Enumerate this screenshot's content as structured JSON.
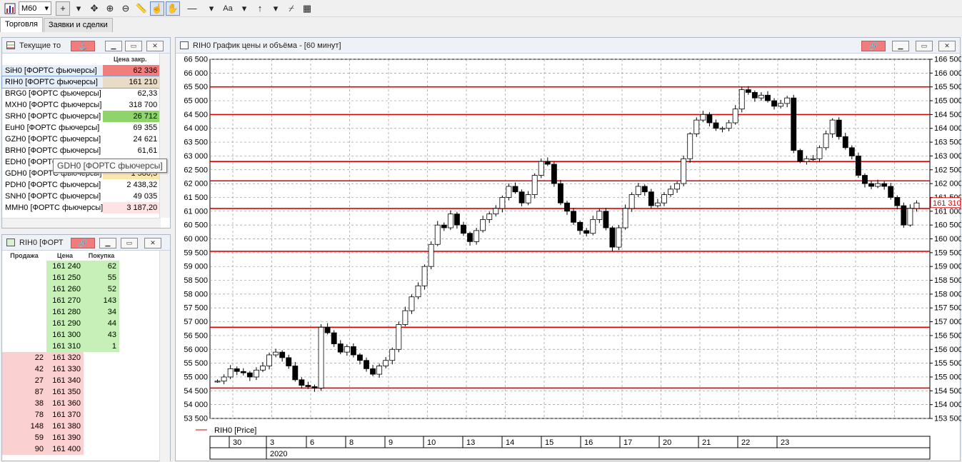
{
  "toolbar": {
    "timeframe": "M60",
    "font_label": "Aa"
  },
  "tabs": [
    {
      "label": "Торговля"
    },
    {
      "label": "Заявки и сделки"
    }
  ],
  "trades_panel": {
    "title": "Текущие то",
    "col_price": "Цена закр.",
    "rows": [
      {
        "name": "SiH0 [ФОРТС фьючерсы]",
        "price": "62 336",
        "bg": "#f17d7d"
      },
      {
        "name": "RIH0 [ФОРТС фьючерсы]",
        "price": "161 210",
        "bg": "#e8dcc7"
      },
      {
        "name": "BRG0 [ФОРТС фьючерсы]",
        "price": "62,33",
        "bg": ""
      },
      {
        "name": "MXH0 [ФОРТС фьючерсы]",
        "price": "318 700",
        "bg": ""
      },
      {
        "name": "SRH0 [ФОРТС фьючерсы]",
        "price": "26 712",
        "bg": "#8fd46a"
      },
      {
        "name": "EuH0 [ФОРТС фьючерсы]",
        "price": "69 355",
        "bg": ""
      },
      {
        "name": "GZH0 [ФОРТС фьючерсы]",
        "price": "24 621",
        "bg": ""
      },
      {
        "name": "BRH0 [ФОРТС фьючерсы]",
        "price": "61,61",
        "bg": ""
      },
      {
        "name": "EDH0 [ФОРТС фьючерсы]",
        "price": "",
        "bg": ""
      },
      {
        "name": "GDH0 [ФОРТС фьючерсы]",
        "price": "1 580,5",
        "bg": "#fbe6ad"
      },
      {
        "name": "PDH0 [ФОРТС фьючерсы]",
        "price": "2 438,32",
        "bg": ""
      },
      {
        "name": "SNH0 [ФОРТС фьючерсы]",
        "price": "49 035",
        "bg": ""
      },
      {
        "name": "MMH0 [ФОРТС фьючерсы]",
        "price": "3 187,20",
        "bg": "#fde3e3"
      }
    ],
    "tooltip": "GDH0 [ФОРТС фьючерсы]"
  },
  "orderbook": {
    "title": "RIH0 [ФОРТ",
    "col_sell": "Продажа",
    "col_price": "Цена",
    "col_buy": "Покупка",
    "bids": [
      {
        "price": "161 240",
        "qty": "62"
      },
      {
        "price": "161 250",
        "qty": "55"
      },
      {
        "price": "161 260",
        "qty": "52"
      },
      {
        "price": "161 270",
        "qty": "143"
      },
      {
        "price": "161 280",
        "qty": "34"
      },
      {
        "price": "161 290",
        "qty": "44"
      },
      {
        "price": "161 300",
        "qty": "43"
      },
      {
        "price": "161 310",
        "qty": "1"
      }
    ],
    "asks": [
      {
        "price": "161 320",
        "qty": "22"
      },
      {
        "price": "161 330",
        "qty": "42"
      },
      {
        "price": "161 340",
        "qty": "27"
      },
      {
        "price": "161 350",
        "qty": "87"
      },
      {
        "price": "161 360",
        "qty": "38"
      },
      {
        "price": "161 370",
        "qty": "78"
      },
      {
        "price": "161 380",
        "qty": "148"
      },
      {
        "price": "161 390",
        "qty": "59"
      },
      {
        "price": "161 400",
        "qty": "90"
      }
    ]
  },
  "chart_window": {
    "title": "RIH0 График цены и объёма - [60 минут]",
    "legend": "RIH0 [Price]",
    "last_price_label": "161 310",
    "year_label": "2020"
  },
  "chart_data": {
    "type": "candlestick",
    "left_axis": {
      "min": 53500,
      "max": 66500,
      "step": 500
    },
    "right_axis": {
      "min": 153500,
      "max": 166500,
      "step": 500
    },
    "x_days": [
      "30",
      "3",
      "6",
      "8",
      "9",
      "10",
      "13",
      "14",
      "15",
      "16",
      "17",
      "20",
      "21",
      "22",
      "23"
    ],
    "level_lines": [
      65500,
      64500,
      62800,
      62100,
      61100,
      59550,
      56800,
      54600
    ],
    "last_price": 161310,
    "series": [
      {
        "name": "RIH0 [Price]",
        "values": [
          154850,
          155000,
          155300,
          155200,
          155150,
          155000,
          155250,
          155400,
          155800,
          155900,
          155700,
          155400,
          154900,
          154700,
          154650,
          154600,
          156800,
          156600,
          156200,
          155900,
          156100,
          155800,
          155600,
          155300,
          155100,
          155400,
          155600,
          156000,
          156900,
          157400,
          157900,
          158300,
          159000,
          159800,
          160500,
          160400,
          160900,
          160500,
          160200,
          159900,
          160300,
          160700,
          160900,
          161100,
          161500,
          161900,
          161700,
          161300,
          161600,
          162300,
          162800,
          162700,
          162000,
          161300,
          161000,
          160600,
          160300,
          160200,
          160700,
          161000,
          160400,
          159700,
          160400,
          161100,
          161600,
          161900,
          161700,
          161200,
          161300,
          161600,
          161800,
          162000,
          162900,
          163800,
          164300,
          164500,
          164200,
          164000,
          164000,
          164200,
          164700,
          165400,
          165300,
          165100,
          165200,
          165000,
          164800,
          164900,
          165100,
          163200,
          162800,
          162900,
          162900,
          163300,
          163800,
          164300,
          163700,
          163300,
          163000,
          162300,
          162000,
          161900,
          162000,
          161900,
          161500,
          161200,
          160500,
          161100,
          161300
        ]
      }
    ]
  }
}
